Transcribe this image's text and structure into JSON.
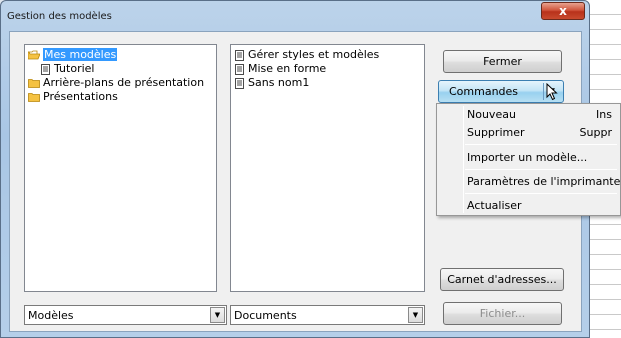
{
  "window": {
    "title": "Gestion des modèles",
    "close_glyph": "x"
  },
  "left_tree": {
    "items": [
      {
        "label": "Mes modèles",
        "icon": "open-folder-icon",
        "selected": true
      },
      {
        "label": "Tutoriel",
        "icon": "document-icon",
        "selected": false
      },
      {
        "label": "Arrière-plans de présentation",
        "icon": "folder-icon",
        "selected": false
      },
      {
        "label": "Présentations",
        "icon": "folder-icon",
        "selected": false
      }
    ]
  },
  "right_tree": {
    "items": [
      {
        "label": "Gérer styles et modèles",
        "icon": "document-icon"
      },
      {
        "label": "Mise en forme",
        "icon": "document-icon"
      },
      {
        "label": "Sans nom1",
        "icon": "document-icon"
      }
    ]
  },
  "left_combo": {
    "value": "Modèles"
  },
  "right_combo": {
    "value": "Documents"
  },
  "buttons": {
    "close": "Fermer",
    "commands": "Commandes",
    "address_book": "Carnet d'adresses...",
    "file": "Fichier..."
  },
  "commands_menu": {
    "items": [
      {
        "label": "Nouveau",
        "shortcut": "Ins"
      },
      {
        "label": "Supprimer",
        "shortcut": "Suppr"
      },
      {
        "label": "Importer un modèle...",
        "shortcut": ""
      },
      {
        "label": "Paramètres de l'imprimante...",
        "shortcut": ""
      },
      {
        "label": "Actualiser",
        "shortcut": ""
      }
    ]
  },
  "colors": {
    "selection": "#3399ff",
    "folder": "#f5c242",
    "titlebar": "#bcd3ea",
    "close_button": "#c94a2e"
  }
}
